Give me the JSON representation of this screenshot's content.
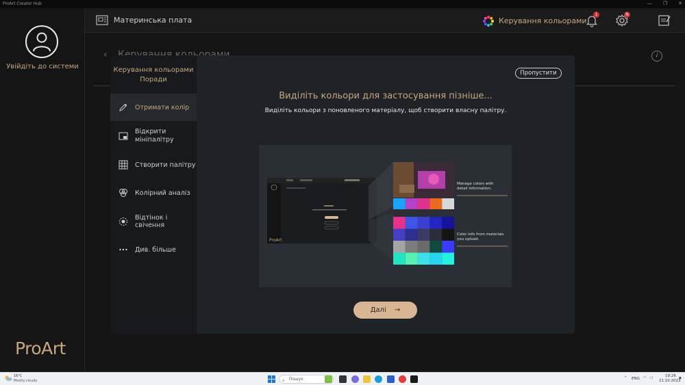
{
  "window": {
    "title": "ProArt Creator Hub",
    "controls": [
      "—",
      "❐",
      "✕"
    ]
  },
  "sidebar": {
    "login_label": "Увійдіть до системи",
    "logo_text": "ProArt"
  },
  "topbar": {
    "motherboard_label": "Материнська плата",
    "color_mgmt_label": "Керування кольорами",
    "bell_badge": "1",
    "gear_badge": "N"
  },
  "background": {
    "page_title": "Керування кольорами",
    "info_glyph": "i"
  },
  "tips": {
    "header_line1": "Керування кольорами",
    "header_line2": "Поради",
    "items": [
      {
        "label": "Отримати колір",
        "icon": "eyedropper-icon"
      },
      {
        "label": "Відкрити мініпалітру",
        "icon": "mini-palette-icon"
      },
      {
        "label": "Створити палітру",
        "icon": "palette-grid-icon"
      },
      {
        "label": "Колірний аналіз",
        "icon": "color-analysis-icon"
      },
      {
        "label": "Відтінок і свічення",
        "icon": "hue-glow-icon"
      },
      {
        "label": "Див. більше",
        "icon": "more-dots-icon"
      }
    ],
    "active_index": 0
  },
  "content": {
    "skip_label": "Пропустити",
    "title": "Виділіть кольори для застосування пізніше...",
    "description": "Виділіть кольори з поновленого матеріалу, щоб створити власну палітру.",
    "next_label": "Далі",
    "preview": {
      "callout1": [
        "Manage colors with",
        "detail information."
      ],
      "callout2": [
        "Color info from materials",
        "you upload."
      ],
      "mini_logo": "ProArt",
      "swatch_row1": [
        "#1aa3ff",
        "#b341c7",
        "#e0318f",
        "#ec6a1e",
        "#d7d7d7"
      ],
      "swatch_grid": [
        "#e8318a",
        "#3c57e6",
        "#3b3fcf",
        "#2224c4",
        "#16129c",
        "#4340c4",
        "#2e2e8f",
        "#3b3b63",
        "#2b2b3a",
        "#141414",
        "#a4a4a4",
        "#7c7c7c",
        "#696969",
        "#0f4a38",
        "#3a3aff",
        "#20e3c2",
        "#56f0b0",
        "#3be0e8",
        "#29d4f0",
        "#22f2de"
      ]
    }
  },
  "taskbar": {
    "temp": "16°C",
    "weather": "Mostly cloudy",
    "search_placeholder": "Пошук",
    "lang": "ENG",
    "time": "19:26",
    "date": "21.10.2023"
  },
  "colors": {
    "accent": "#c9a87c",
    "next_button": "#d9b693",
    "modal_bg": "#1f2227"
  }
}
